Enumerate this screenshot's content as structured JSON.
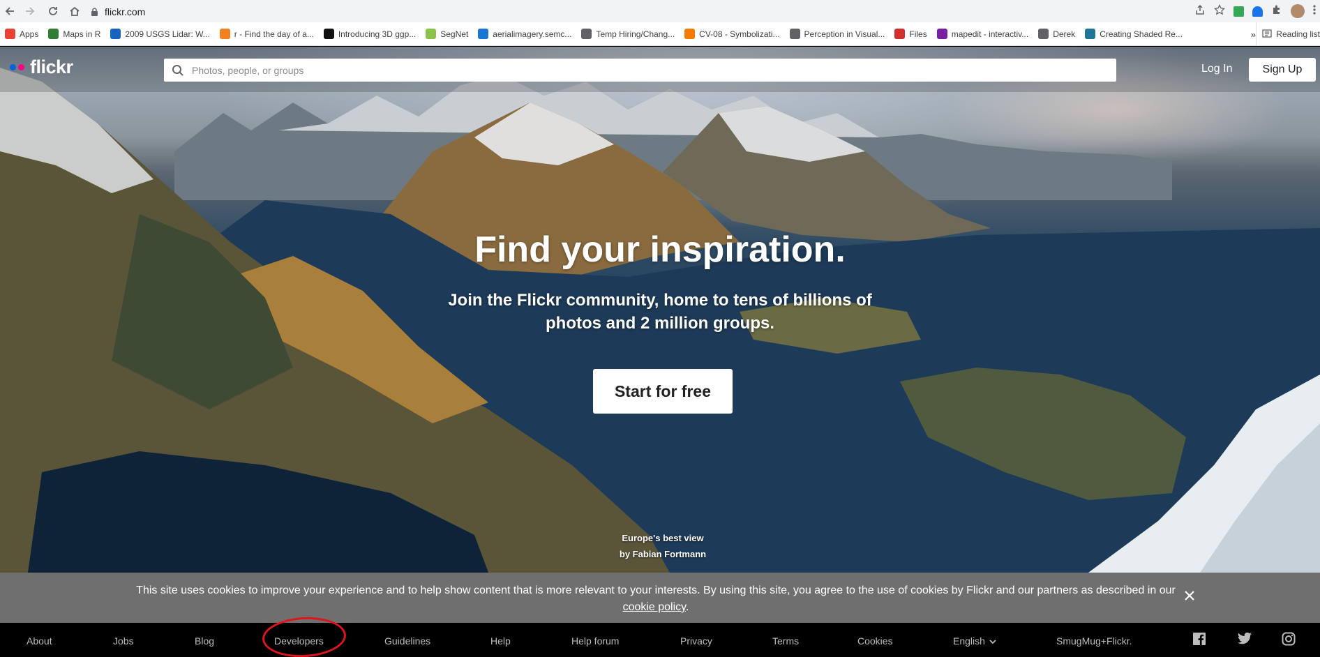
{
  "browser": {
    "url": "flickr.com",
    "bookmarks": [
      {
        "label": "Apps",
        "color": "#e94235"
      },
      {
        "label": "Maps in R",
        "color": "#2e7d32"
      },
      {
        "label": "2009 USGS Lidar: W...",
        "color": "#1565c0"
      },
      {
        "label": "r - Find the day of a...",
        "color": "#f48024"
      },
      {
        "label": "Introducing 3D ggp...",
        "color": "#111111"
      },
      {
        "label": "SegNet",
        "color": "#8bc34a"
      },
      {
        "label": "aerialimagery.semc...",
        "color": "#1976d2"
      },
      {
        "label": "Temp Hiring/Chang...",
        "color": "#5f6368"
      },
      {
        "label": "CV-08 - Symbolizati...",
        "color": "#f57c00"
      },
      {
        "label": "Perception in Visual...",
        "color": "#5f6368"
      },
      {
        "label": "Files",
        "color": "#d32f2f"
      },
      {
        "label": "mapedit - interactiv...",
        "color": "#7b1fa2"
      },
      {
        "label": "Derek",
        "color": "#5f6368"
      },
      {
        "label": "Creating Shaded Re...",
        "color": "#21759b"
      }
    ],
    "more_label": "»",
    "reading_list": "Reading list"
  },
  "header": {
    "logo_text": "flickr",
    "logo_colors": [
      "#0063dc",
      "#ff0084"
    ],
    "search_placeholder": "Photos, people, or groups",
    "login": "Log In",
    "signup": "Sign Up"
  },
  "hero": {
    "title": "Find your inspiration.",
    "subtitle": "Join the Flickr community, home to tens of billions of photos and 2 million groups.",
    "cta": "Start for free",
    "photo_title": "Europe's best view",
    "photo_credit": "by Fabian Fortmann"
  },
  "cookie": {
    "text": "This site uses cookies to improve your experience and to help show content that is more relevant to your interests. By using this site, you agree to the use of cookies by Flickr and our partners as described in our",
    "link": "cookie policy",
    "end": "."
  },
  "footer": {
    "items": [
      "About",
      "Jobs",
      "Blog",
      "Developers",
      "Guidelines",
      "Help",
      "Help forum",
      "Privacy",
      "Terms",
      "Cookies",
      "English",
      "SmugMug+Flickr."
    ],
    "social": [
      "facebook-icon",
      "twitter-icon",
      "instagram-icon"
    ]
  }
}
